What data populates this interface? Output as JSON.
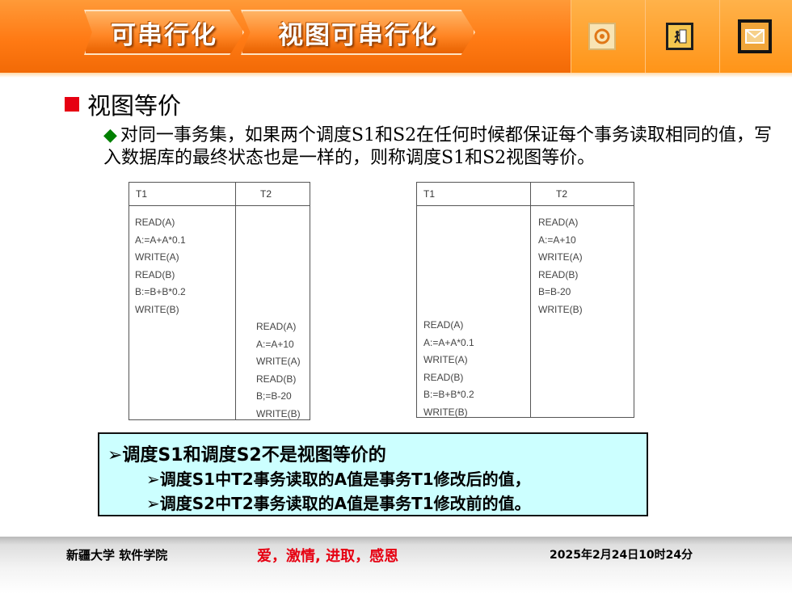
{
  "header": {
    "tabs": [
      "可串行化",
      "视图可串行化"
    ],
    "buttons": [
      {
        "icon": "target-icon"
      },
      {
        "icon": "exit-door-icon"
      },
      {
        "icon": "mail-icon"
      }
    ]
  },
  "section": {
    "title": "视图等价",
    "bullet_color": "#e60012",
    "paragraph": "对同一事务集，如果两个调度S1和S2在任何时候都保证每个事务读取相同的值，写入数据库的最终状态也是一样的，则称调度S1和S2视图等价。"
  },
  "schedule1": {
    "headers": [
      "T1",
      "T2"
    ],
    "t1_ops": [
      "READ(A)",
      "A:=A+A*0.1",
      "WRITE(A)",
      "READ(B)",
      "B:=B+B*0.2",
      "WRITE(B)"
    ],
    "t2_ops": [
      "READ(A)",
      "A:=A+10",
      "WRITE(A)",
      "READ(B)",
      "B;=B-20",
      "WRITE(B)"
    ]
  },
  "schedule2": {
    "headers": [
      "T1",
      "T2"
    ],
    "t2_ops": [
      "READ(A)",
      "A:=A+10",
      "WRITE(A)",
      "READ(B)",
      "B=B-20",
      "WRITE(B)"
    ],
    "t1_ops": [
      "READ(A)",
      "A:=A+A*0.1",
      "WRITE(A)",
      "READ(B)",
      "B:=B+B*0.2",
      "WRITE(B)"
    ]
  },
  "conclusion": {
    "line1": "➢调度S1和调度S2不是视图等价的",
    "line2": "➢调度S1中T2事务读取的A值是事务T1修改后的值，",
    "line3": "➢调度S2中T2事务读取的A值是事务T1修改前的值。"
  },
  "footer": {
    "school": "新疆大学 软件学院",
    "motto": "爱，激情,  进取，感恩",
    "datetime": "2025年2月24日10时24分"
  },
  "colors": {
    "header_orange": "#ff7a14",
    "accent_red": "#e60012",
    "diamond_green": "#008000",
    "conclusion_bg": "#ccffff"
  }
}
